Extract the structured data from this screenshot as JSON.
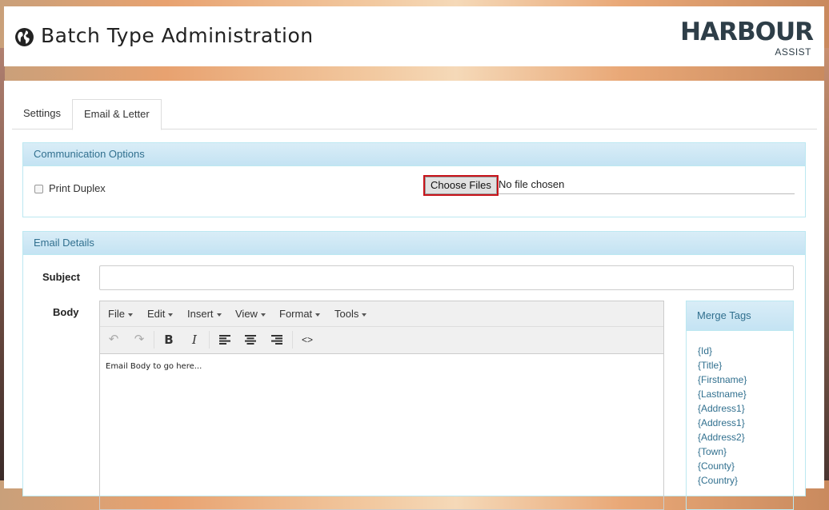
{
  "header": {
    "title": "Batch Type Administration",
    "logo_text": "HARBOUR",
    "logo_subtext": "ASSIST"
  },
  "tabs": [
    {
      "label": "Settings",
      "active": false
    },
    {
      "label": "Email & Letter",
      "active": true
    }
  ],
  "communication": {
    "heading": "Communication Options",
    "print_duplex_label": "Print Duplex",
    "print_duplex_checked": false,
    "choose_files_label": "Choose Files",
    "file_status": "No file chosen"
  },
  "email": {
    "heading": "Email Details",
    "subject_label": "Subject",
    "subject_value": "",
    "body_label": "Body",
    "menu": [
      "File",
      "Edit",
      "Insert",
      "View",
      "Format",
      "Tools"
    ],
    "toolbar_icons": [
      "undo-icon",
      "redo-icon",
      "bold-icon",
      "italic-icon",
      "align-left-icon",
      "align-center-icon",
      "align-right-icon",
      "source-code-icon"
    ],
    "body_content": "Email Body to go here..."
  },
  "merge_tags": {
    "heading": "Merge Tags",
    "items": [
      "{Id}",
      "{Title}",
      "{Firstname}",
      "{Lastname}",
      "{Address1}",
      "{Address1}",
      "{Address2}",
      "{Town}",
      "{County}",
      "{Country}"
    ]
  },
  "colors": {
    "panel_heading_text": "#31708f",
    "panel_heading_bg": "#d9edf7",
    "highlight_border": "#c8141b",
    "logo": "#2e3e48"
  }
}
